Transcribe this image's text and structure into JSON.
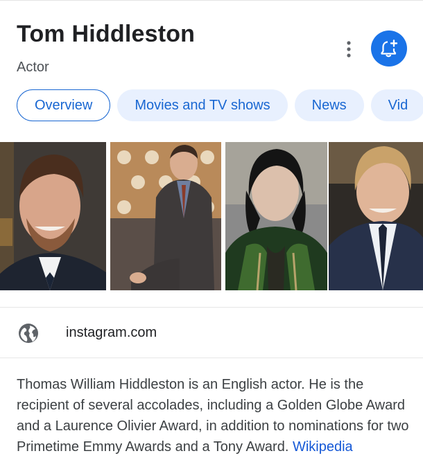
{
  "header": {
    "title": "Tom Hiddleston",
    "subtitle": "Actor"
  },
  "actions": {
    "more_icon": "more-vert-icon",
    "notify_icon": "bell-plus-icon",
    "accent": "#1a73e8"
  },
  "tabs": [
    {
      "label": "Overview",
      "active": true
    },
    {
      "label": "Movies and TV shows",
      "active": false
    },
    {
      "label": "News",
      "active": false
    },
    {
      "label": "Vid",
      "active": false
    }
  ],
  "images": [
    {
      "subject": "portrait-smiling"
    },
    {
      "subject": "seated-suit"
    },
    {
      "subject": "loki-costume"
    },
    {
      "subject": "blond-man-suit"
    }
  ],
  "source": {
    "icon": "globe-icon",
    "text": "instagram.com"
  },
  "description": {
    "text": "Thomas William Hiddleston is an English actor. He is the recipient of several accolades, including a Golden Globe Award and a Laurence Olivier Award, in addition to nominations for two Primetime Emmy Awards and a Tony Award.",
    "link": "Wikipedia"
  }
}
